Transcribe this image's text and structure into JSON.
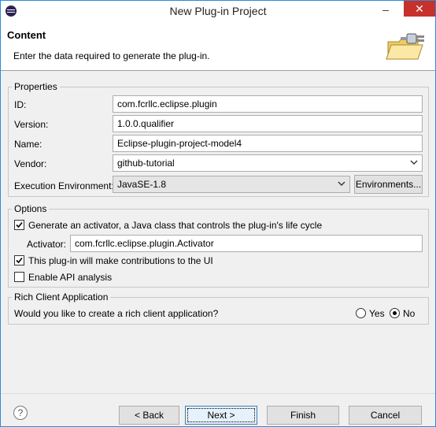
{
  "window": {
    "title": "New Plug-in Project",
    "minimize": "–",
    "close": "✕"
  },
  "header": {
    "title": "Content",
    "description": "Enter the data required to generate the plug-in."
  },
  "properties": {
    "legend": "Properties",
    "id_label": "ID:",
    "id_value": "com.fcrllc.eclipse.plugin",
    "version_label": "Version:",
    "version_value": "1.0.0.qualifier",
    "name_label": "Name:",
    "name_value": "Eclipse-plugin-project-model4",
    "vendor_label": "Vendor:",
    "vendor_value": "github-tutorial",
    "env_label": "Execution Environment:",
    "env_value": "JavaSE-1.8",
    "environments_button": "Environments..."
  },
  "options": {
    "legend": "Options",
    "activator_check_label": "Generate an activator, a Java class that controls the plug-in's life cycle",
    "activator_checked": true,
    "activator_label": "Activator:",
    "activator_value": "com.fcrllc.eclipse.plugin.Activator",
    "ui_check_label": "This plug-in will make contributions to the UI",
    "ui_checked": true,
    "api_check_label": "Enable API analysis",
    "api_checked": false
  },
  "rca": {
    "legend": "Rich Client Application",
    "question": "Would you like to create a rich client application?",
    "yes_label": "Yes",
    "no_label": "No",
    "selected": "No"
  },
  "buttons": {
    "help": "?",
    "back": "< Back",
    "next": "Next >",
    "finish": "Finish",
    "cancel": "Cancel"
  },
  "icons": {
    "app": "eclipse-icon",
    "header": "folder-plugin-icon",
    "chevron": "chevron-down-icon",
    "help": "help-icon"
  }
}
